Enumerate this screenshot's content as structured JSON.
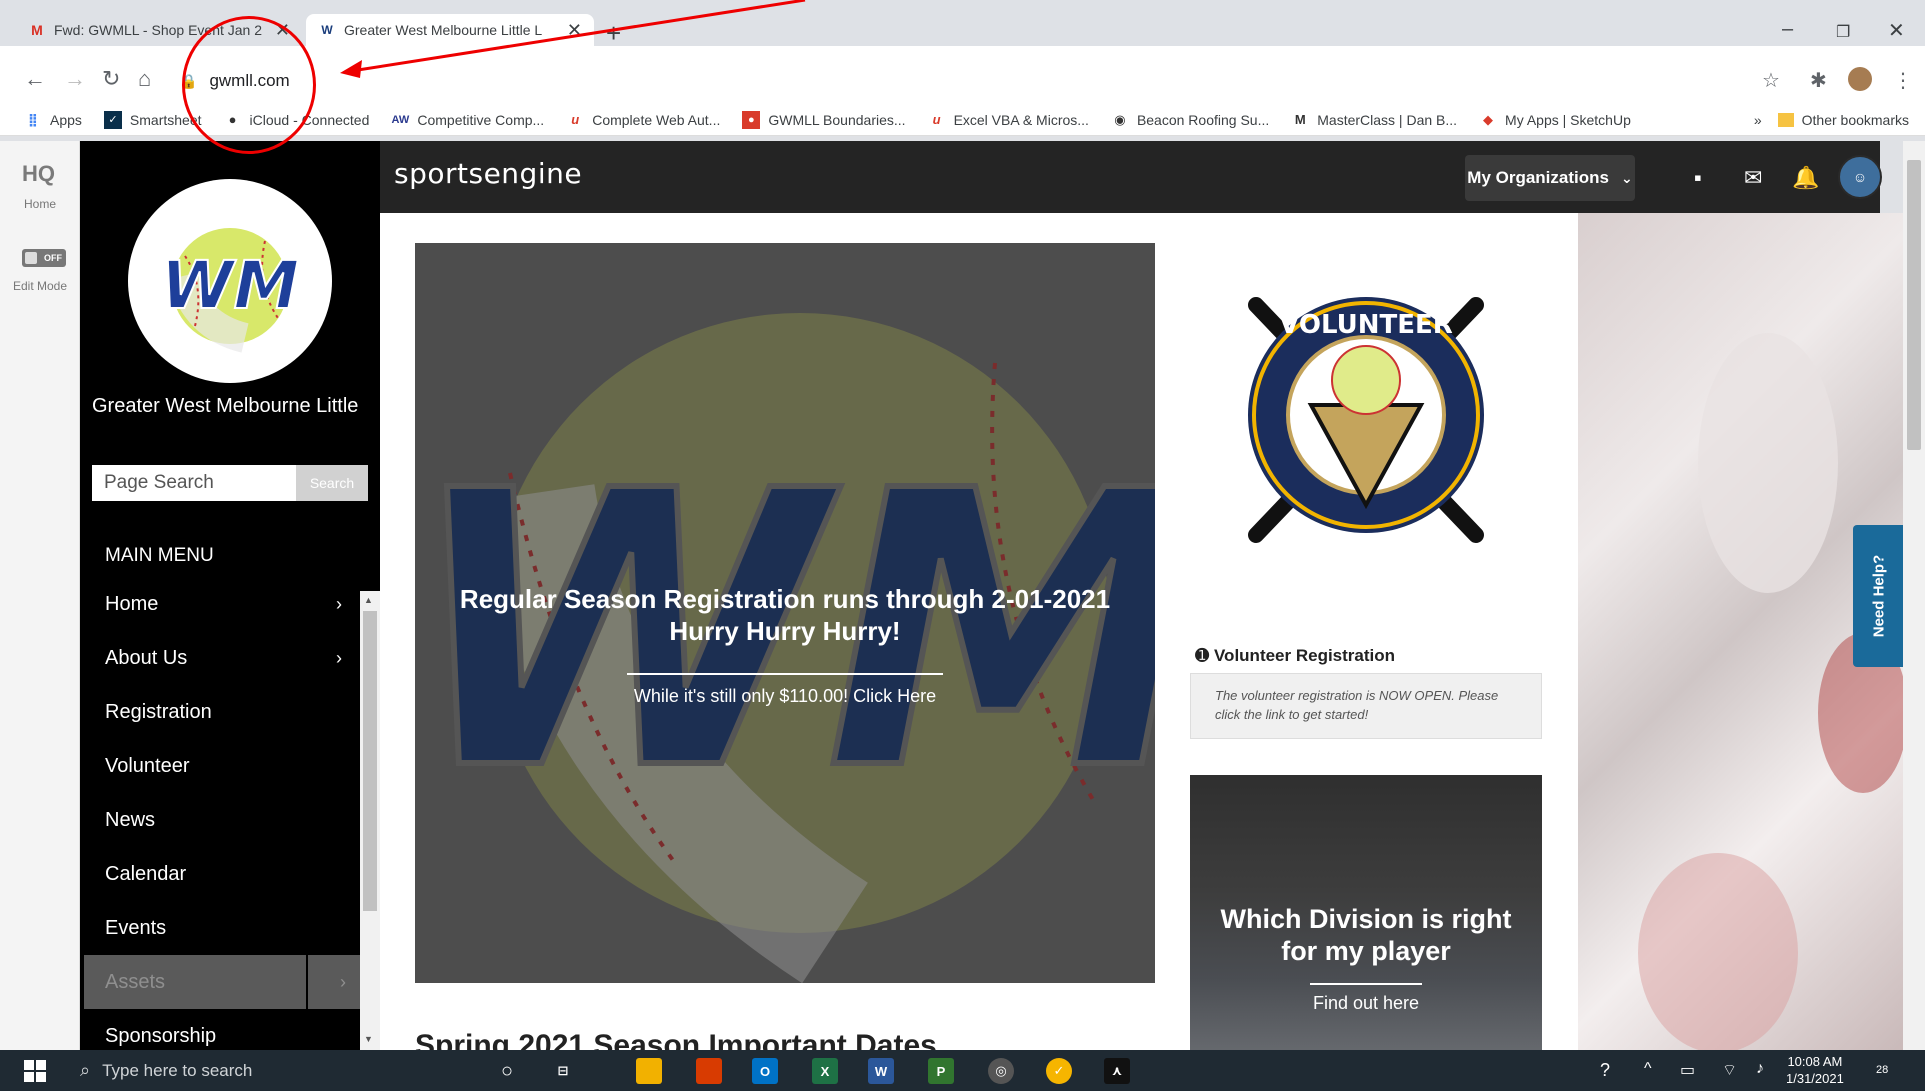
{
  "browser": {
    "tabs": [
      {
        "title": "Fwd: GWMLL - Shop Event Jan 2",
        "icon": "gmail-icon"
      },
      {
        "title": "Greater West Melbourne Little L",
        "icon": "gwmll-favicon"
      }
    ],
    "url": "gwmll.com",
    "bookmarks": [
      {
        "label": "Apps",
        "icon": "apps-grid-icon",
        "color": "#4285f4"
      },
      {
        "label": "Smartsheet",
        "icon": "smartsheet-icon",
        "color": "#0a2f4a"
      },
      {
        "label": "iCloud - Connected",
        "icon": "apple-icon",
        "color": "#333333"
      },
      {
        "label": "Competitive Comp...",
        "icon": "aw-icon",
        "color": "#2b3a8f"
      },
      {
        "label": "Complete Web Aut...",
        "icon": "wu-icon",
        "color": "#d93b2b"
      },
      {
        "label": "GWMLL Boundaries...",
        "icon": "map-pin-icon",
        "color": "#d93b2b"
      },
      {
        "label": "Excel VBA & Micros...",
        "icon": "wu-icon",
        "color": "#d93b2b"
      },
      {
        "label": "Beacon Roofing Su...",
        "icon": "globe-icon",
        "color": "#333333"
      },
      {
        "label": "MasterClass | Dan B...",
        "icon": "masterclass-icon",
        "color": "#333333"
      },
      {
        "label": "My Apps | SketchUp",
        "icon": "sketchup-icon",
        "color": "#d93b2b"
      }
    ],
    "other_bookmarks": "Other bookmarks",
    "overflow": "»"
  },
  "hq": {
    "logo": "HQ",
    "home_label": "Home",
    "toggle_label": "OFF",
    "edit_mode_label": "Edit Mode"
  },
  "sidebar": {
    "org_name": "Greater West Melbourne Little",
    "logo_text": "WM",
    "search_placeholder": "Page Search",
    "search_button": "Search",
    "menu_heading": "MAIN MENU",
    "menu": [
      {
        "label": "Home",
        "has_children": true
      },
      {
        "label": "About Us",
        "has_children": true
      },
      {
        "label": "Registration",
        "has_children": false
      },
      {
        "label": "Volunteer",
        "has_children": false
      },
      {
        "label": "News",
        "has_children": false
      },
      {
        "label": "Calendar",
        "has_children": false
      },
      {
        "label": "Events",
        "has_children": false
      },
      {
        "label": "Assets",
        "has_children": true
      },
      {
        "label": "Sponsorship",
        "has_children": false
      }
    ]
  },
  "header": {
    "brand": "sportsengine",
    "org_button": "My Organizations"
  },
  "main": {
    "hero": {
      "title_line1": "Regular Season Registration runs through 2-01-2021",
      "title_line2": "Hurry Hurry Hurry!",
      "subtitle": "While it's still only $110.00! Click Here",
      "logo_text": "WM"
    },
    "volunteer": {
      "badge_text": "VOLUNTEER",
      "title": "Volunteer Registration",
      "description": "The volunteer registration is NOW OPEN. Please click the link to get started!"
    },
    "division": {
      "title_line1": "Which Division is right",
      "title_line2": "for my player",
      "link": "Find out here"
    },
    "section_heading": "Spring 2021 Season Important Dates"
  },
  "need_help": "Need Help?",
  "taskbar": {
    "search_placeholder": "Type here to search",
    "time": "10:08 AM",
    "date": "1/31/2021",
    "notifications": "28"
  }
}
